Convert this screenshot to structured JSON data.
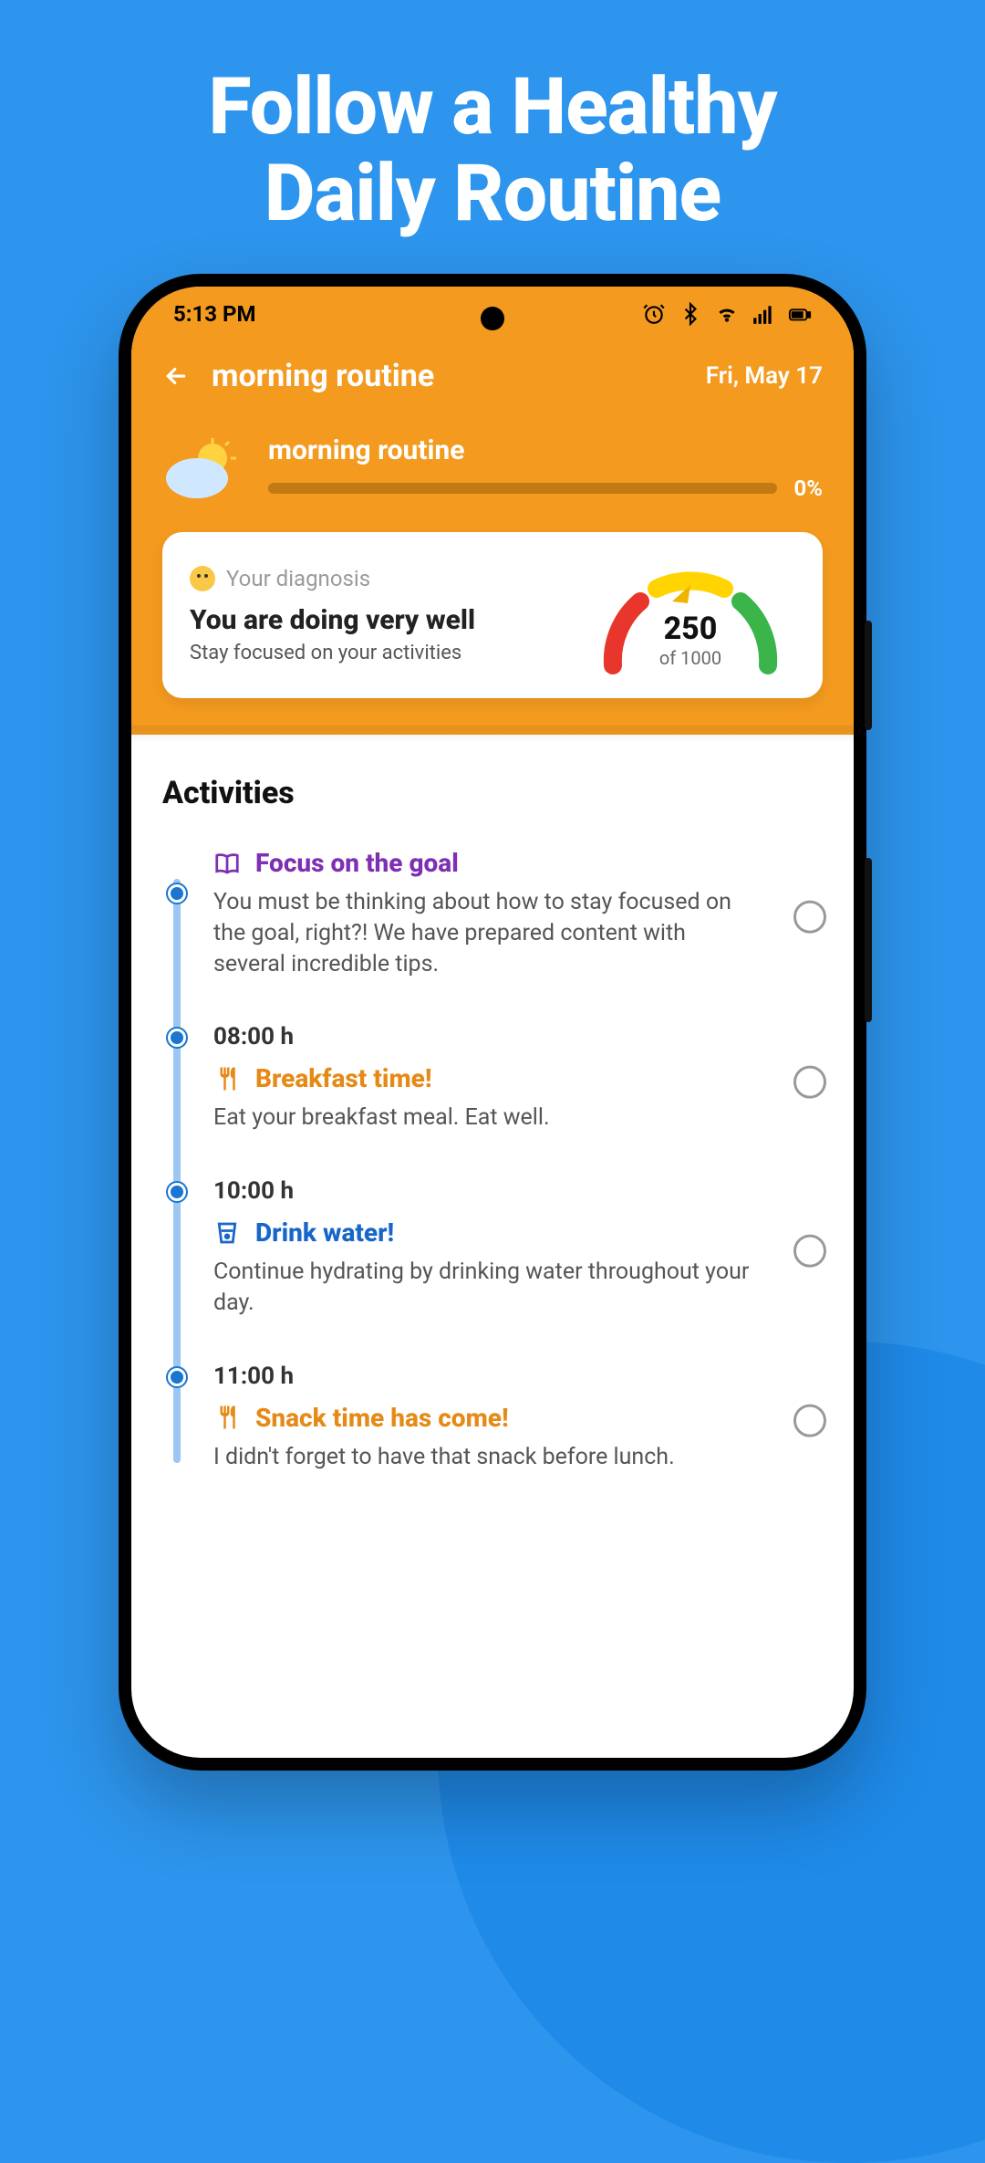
{
  "hero": {
    "line1": "Follow a Healthy",
    "line2": "Daily Routine"
  },
  "statusbar": {
    "time": "5:13 PM"
  },
  "appbar": {
    "title": "morning routine",
    "date": "Fri, May 17"
  },
  "routine": {
    "label": "morning routine",
    "progress_pct": "0%"
  },
  "diagnosis": {
    "hint": "Your diagnosis",
    "title": "You are doing very well",
    "subtitle": "Stay focused on your activities",
    "value": "250",
    "of": "of 1000"
  },
  "section_title": "Activities",
  "activities": [
    {
      "time": "",
      "title": "Focus on the goal",
      "desc": "You must be thinking about how to stay focused on the goal, right?! We have prepared content with several incredible tips.",
      "color": "c-purple",
      "icon": "book"
    },
    {
      "time": "08:00 h",
      "title": "Breakfast time!",
      "desc": "Eat your breakfast meal. Eat well.",
      "color": "c-orange",
      "icon": "fork"
    },
    {
      "time": "10:00 h",
      "title": "Drink water!",
      "desc": "Continue hydrating by drinking water throughout your day.",
      "color": "c-blue",
      "icon": "cup"
    },
    {
      "time": "11:00 h",
      "title": "Snack time has come!",
      "desc": "I didn't forget to have that snack before lunch.",
      "color": "c-orange",
      "icon": "fork"
    }
  ]
}
